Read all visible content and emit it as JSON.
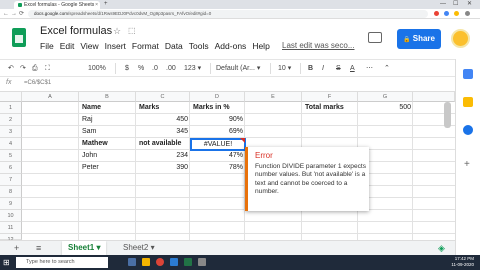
{
  "browser": {
    "tab_title": "Excel formulas - Google Sheets",
    "tab_close": "×",
    "new_tab": "+",
    "url_host": "docs.google.com",
    "url_path": "/spreadsheets/d/1Rws9EDJ0Pdvc0dvM_Og9p3pasrs_FAfvO/edit#gid=0",
    "back": "←",
    "forward": "→",
    "reload": "⟳",
    "minimize": "—",
    "maximize": "☐",
    "close": "✕"
  },
  "header": {
    "title": "Excel formulas",
    "star_icon": "☆",
    "move_icon": "⬚",
    "menus": [
      "File",
      "Edit",
      "View",
      "Insert",
      "Format",
      "Data",
      "Tools",
      "Add-ons",
      "Help"
    ],
    "last_edit": "Last edit was seco...",
    "share_label": "Share",
    "share_icon": "🔒"
  },
  "toolbar": {
    "undo": "↶",
    "redo": "↷",
    "print": "⎙",
    "paint": "⛶",
    "zoom": "100%",
    "currency": "$",
    "percent": "%",
    "dec0": ".0",
    "dec00": ".00",
    "format123": "123 ▾",
    "font": "Default (Ar... ▾",
    "size": "10 ▾",
    "bold": "B",
    "italic": "I",
    "strike": "S",
    "color": "A",
    "more": "⋯",
    "collapse": "⌃"
  },
  "formula_bar": {
    "fx": "fx",
    "value": "=C6/$C$1"
  },
  "columns": [
    "A",
    "B",
    "C",
    "D",
    "E",
    "F",
    "G"
  ],
  "rows": [
    "1",
    "2",
    "3",
    "4",
    "5",
    "6",
    "7",
    "8",
    "9",
    "10",
    "11",
    "12"
  ],
  "cells": {
    "b1": "Name",
    "c1": "Marks",
    "d1": "Marks in %",
    "f1": "Total marks",
    "g1": "500",
    "b2": "Raj",
    "c2": "450",
    "d2": "90%",
    "b3": "Sam",
    "c3": "345",
    "d3": "69%",
    "b4": "Mathew",
    "c4": "not available",
    "d4": "#VALUE!",
    "b5": "John",
    "c5": "234",
    "d5": "47%",
    "b6": "Peter",
    "c6": "390",
    "d6": "78%"
  },
  "error": {
    "title": "Error",
    "message": "Function DIVIDE parameter 1 expects number values. But 'not available' is a text and cannot be coerced to a number."
  },
  "sheets": {
    "add": "+",
    "list": "≡",
    "tabs": [
      {
        "label": "Sheet1 ▾",
        "active": true
      },
      {
        "label": "Sheet2 ▾",
        "active": false
      }
    ],
    "explore": "◈"
  },
  "taskbar": {
    "start": "⊞",
    "search_placeholder": "Type here to search",
    "time": "17:42 PM",
    "date": "11-09-2020"
  },
  "colors": {
    "accent": "#1a73e8",
    "sheets_green": "#0f9d58",
    "error_orange": "#e8710a",
    "error_red": "#d93025"
  }
}
